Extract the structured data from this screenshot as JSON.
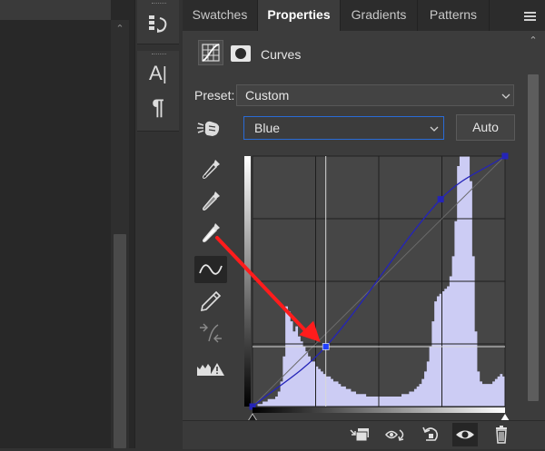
{
  "tabs": [
    {
      "label": "Swatches",
      "active": false
    },
    {
      "label": "Properties",
      "active": true
    },
    {
      "label": "Gradients",
      "active": false
    },
    {
      "label": "Patterns",
      "active": false
    }
  ],
  "properties": {
    "title": "Curves",
    "preset_label": "Preset:",
    "preset_value": "Custom",
    "channel_value": "Blue",
    "auto_label": "Auto"
  },
  "tool_strip": {
    "icons": [
      "history-brush-icon",
      "character-icon",
      "paragraph-icon"
    ],
    "glyph_A": "A",
    "glyph_para": "¶"
  },
  "side_tools": [
    {
      "name": "black-eyedropper-icon",
      "active": false
    },
    {
      "name": "gray-eyedropper-icon",
      "active": false
    },
    {
      "name": "white-eyedropper-icon",
      "active": false
    },
    {
      "name": "curve-edit-icon",
      "active": true
    },
    {
      "name": "pencil-icon",
      "active": false
    },
    {
      "name": "smooth-curve-icon",
      "active": false
    },
    {
      "name": "clipping-warning-icon",
      "active": false
    }
  ],
  "bottom_bar": [
    {
      "name": "clip-to-layer-icon",
      "active": false
    },
    {
      "name": "view-previous-icon",
      "active": false
    },
    {
      "name": "reset-icon",
      "active": false
    },
    {
      "name": "visibility-eye-icon",
      "active": true
    },
    {
      "name": "trash-icon",
      "active": false
    }
  ],
  "curve": {
    "range": [
      0,
      255
    ],
    "grid_divisions": 4,
    "points": [
      [
        0,
        0
      ],
      [
        74,
        61
      ],
      [
        190,
        211
      ],
      [
        255,
        255
      ]
    ],
    "histogram": [
      0,
      0,
      1,
      1,
      2,
      2,
      3,
      3,
      3,
      4,
      6,
      10,
      20,
      40,
      38,
      34,
      30,
      32,
      28,
      26,
      24,
      22,
      20,
      18,
      18,
      16,
      15,
      14,
      13,
      12,
      12,
      11,
      10,
      10,
      9,
      8,
      8,
      7,
      7,
      6,
      6,
      5,
      5,
      5,
      5,
      4,
      4,
      4,
      4,
      4,
      4,
      4,
      4,
      4,
      4,
      4,
      4,
      4,
      4,
      5,
      5,
      5,
      6,
      6,
      7,
      8,
      9,
      11,
      14,
      18,
      24,
      34,
      42,
      44,
      45,
      46,
      47,
      48,
      52,
      60,
      74,
      96,
      100,
      100,
      100,
      100,
      90,
      60,
      30,
      14,
      10,
      9,
      9,
      9,
      9,
      10,
      11,
      12,
      13,
      12
    ],
    "color_curve": "#2424b8",
    "color_histogram": "#ccccf4",
    "color_selected_point": "#1f3fff",
    "arrow_color": "#ff1c1c"
  }
}
